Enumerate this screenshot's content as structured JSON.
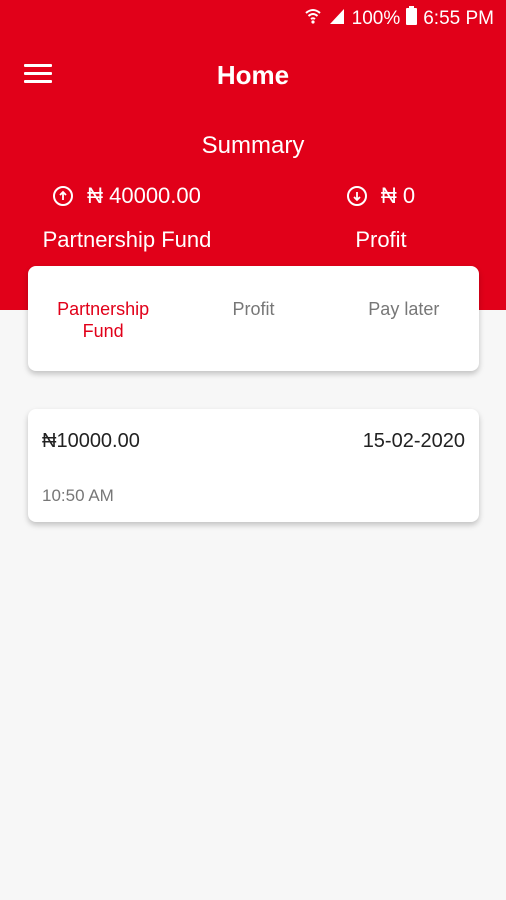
{
  "status_bar": {
    "battery": "100%",
    "time": "6:55 PM"
  },
  "app_bar": {
    "title": "Home"
  },
  "summary": {
    "title": "Summary",
    "fund_amount": "₦ 40000.00",
    "fund_label": "Partnership Fund",
    "profit_amount": "₦ 0",
    "profit_label": "Profit"
  },
  "tabs": [
    {
      "label_line1": "Partnership",
      "label_line2": "Fund",
      "active": true
    },
    {
      "label_line1": "Profit",
      "label_line2": "",
      "active": false
    },
    {
      "label_line1": "Pay later",
      "label_line2": "",
      "active": false
    }
  ],
  "entries": [
    {
      "amount": "₦10000.00",
      "date": "15-02-2020",
      "time": "10:50 AM"
    }
  ],
  "colors": {
    "brand_red": "#e10019",
    "background": "#f7f7f7"
  }
}
